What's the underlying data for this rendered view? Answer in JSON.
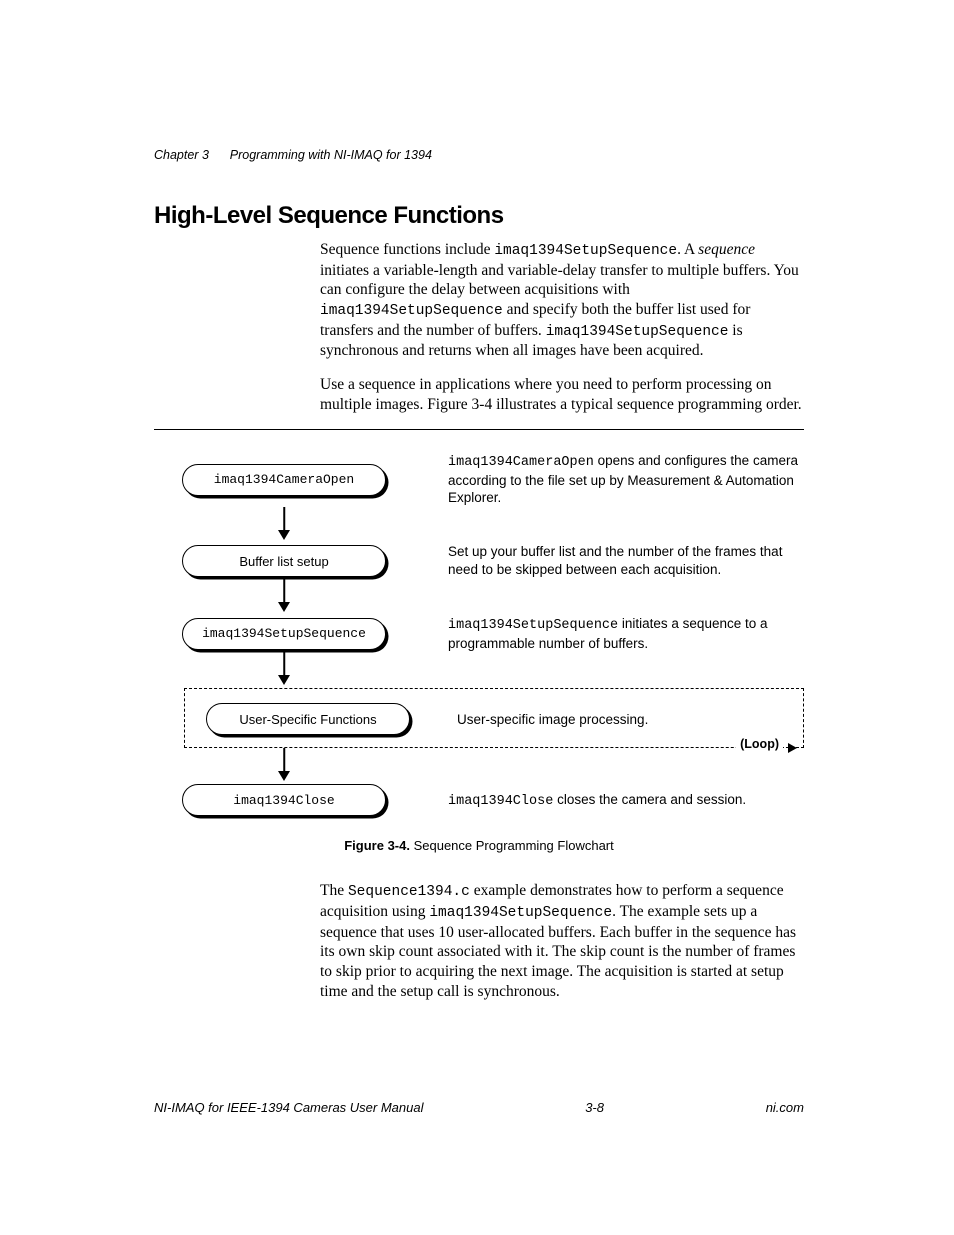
{
  "running_head": {
    "chapter": "Chapter 3",
    "title": "Programming with NI-IMAQ for 1394"
  },
  "heading": "High-Level Sequence Functions",
  "para1": {
    "t1": "Sequence functions include ",
    "c1": "imaq1394SetupSequence",
    "t2": ". A ",
    "i1": "sequence",
    "t3": " initiates a variable-length and variable-delay transfer to multiple buffers. You can configure the delay between acquisitions with ",
    "c2": "imaq1394SetupSequence",
    "t4": " and specify both the buffer list used for transfers and the number of buffers. ",
    "c3": "imaq1394SetupSequence",
    "t5": " is synchronous and returns when all images have been acquired."
  },
  "para2": "Use a sequence in applications where you need to perform processing on multiple images. Figure 3-4 illustrates a typical sequence programming order.",
  "flow": {
    "n1": "imaq1394CameraOpen",
    "d1a": "imaq1394CameraOpen",
    "d1b": " opens and configures the camera according to the file set up by Measurement & Automation Explorer.",
    "n2": "Buffer list setup",
    "d2": "Set up your buffer list and the number of the frames that need to be skipped between each acquisition.",
    "n3": "imaq1394SetupSequence",
    "d3a": "imaq1394SetupSequence",
    "d3b": " initiates a sequence to a programmable number of buffers.",
    "n4": "User-Specific Functions",
    "d4": "User-specific image processing.",
    "loop": "(Loop)",
    "n5": "imaq1394Close",
    "d5a": "imaq1394Close",
    "d5b": " closes the camera and session."
  },
  "caption": {
    "label": "Figure 3-4.",
    "text": "  Sequence Programming Flowchart"
  },
  "para3": {
    "t1": "The ",
    "c1": "Sequence1394.c",
    "t2": " example demonstrates how to perform a sequence acquisition using ",
    "c2": "imaq1394SetupSequence",
    "t3": ". The example sets up a sequence that uses 10 user-allocated buffers. Each buffer in the sequence has its own skip count associated with it. The skip count is the number of frames to skip prior to acquiring the next image. The acquisition is started at setup time and the setup call is synchronous."
  },
  "footer": {
    "left": "NI-IMAQ for IEEE-1394 Cameras User Manual",
    "center": "3-8",
    "right": "ni.com"
  }
}
